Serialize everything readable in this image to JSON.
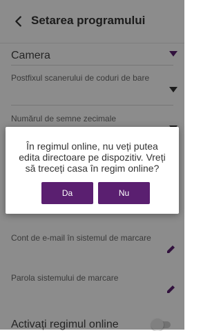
{
  "header": {
    "title": "Setarea programului"
  },
  "camera": {
    "label": "Camera"
  },
  "fields": {
    "barcode_suffix": "Postfixul scanerului de coduri de bare",
    "decimals": "Numărul de semne zecimale",
    "email": "Cont de e-mail în sistemul de marcare",
    "password": "Parola sistemului de marcare",
    "online_mode": "Activați regimul online"
  },
  "dialog": {
    "message": "În regimul online, nu veți putea edita directoare pe dispozitiv. Vreți să treceți casa în regim online?",
    "yes": "Da",
    "no": "Nu"
  },
  "colors": {
    "primary_button": "#5a1f70",
    "overlay": "#000000"
  },
  "icons": {
    "back": "chevron-left-icon",
    "dropdown": "triangle-down-icon",
    "edit": "pencil-icon",
    "toggle": "toggle-switch"
  },
  "toggle_state": {
    "online_enabled": false
  }
}
